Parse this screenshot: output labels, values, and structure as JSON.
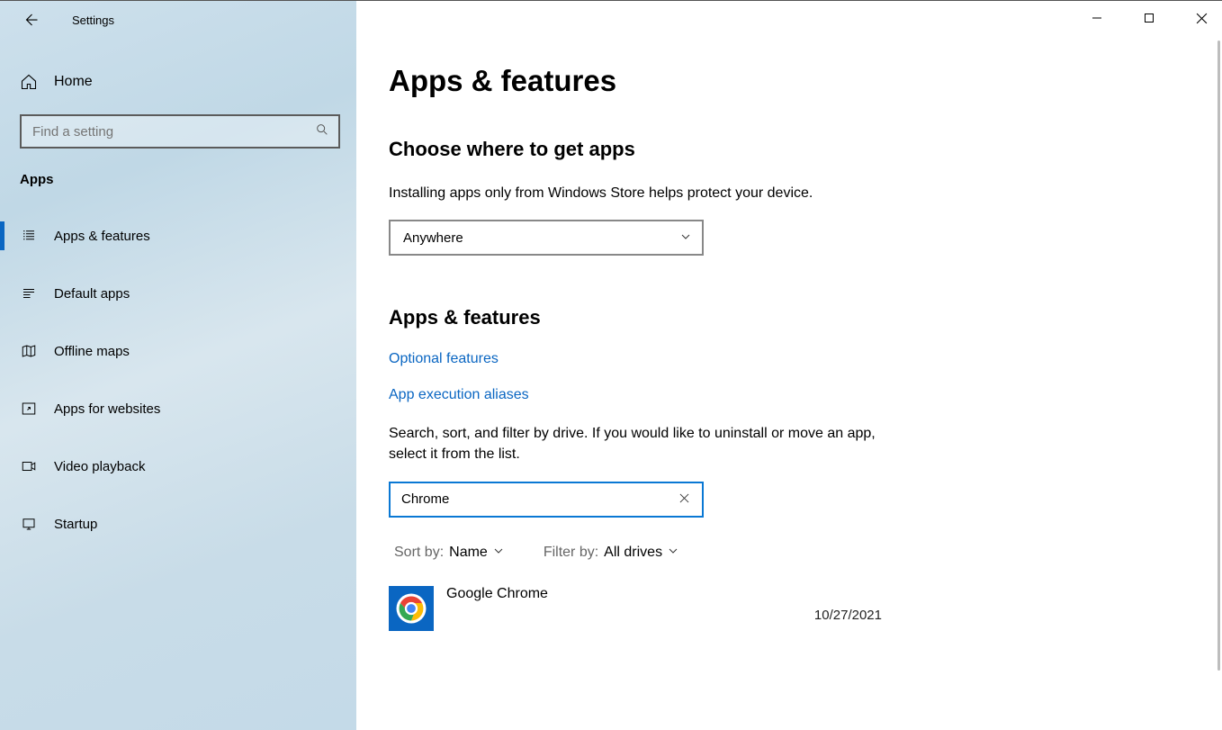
{
  "window_title": "Settings",
  "sidebar": {
    "home_label": "Home",
    "search_placeholder": "Find a setting",
    "section_label": "Apps",
    "items": [
      {
        "label": "Apps & features"
      },
      {
        "label": "Default apps"
      },
      {
        "label": "Offline maps"
      },
      {
        "label": "Apps for websites"
      },
      {
        "label": "Video playback"
      },
      {
        "label": "Startup"
      }
    ]
  },
  "main": {
    "page_title": "Apps & features",
    "choose_section": {
      "heading": "Choose where to get apps",
      "description": "Installing apps only from Windows Store helps protect your device.",
      "dropdown_value": "Anywhere"
    },
    "features_section": {
      "heading": "Apps & features",
      "link_optional": "Optional features",
      "link_aliases": "App execution aliases",
      "description": "Search, sort, and filter by drive. If you would like to uninstall or move an app, select it from the list.",
      "search_value": "Chrome",
      "sort_label": "Sort by:",
      "sort_value": "Name",
      "filter_label": "Filter by:",
      "filter_value": "All drives",
      "apps": [
        {
          "name": "Google Chrome",
          "date": "10/27/2021"
        }
      ]
    }
  }
}
